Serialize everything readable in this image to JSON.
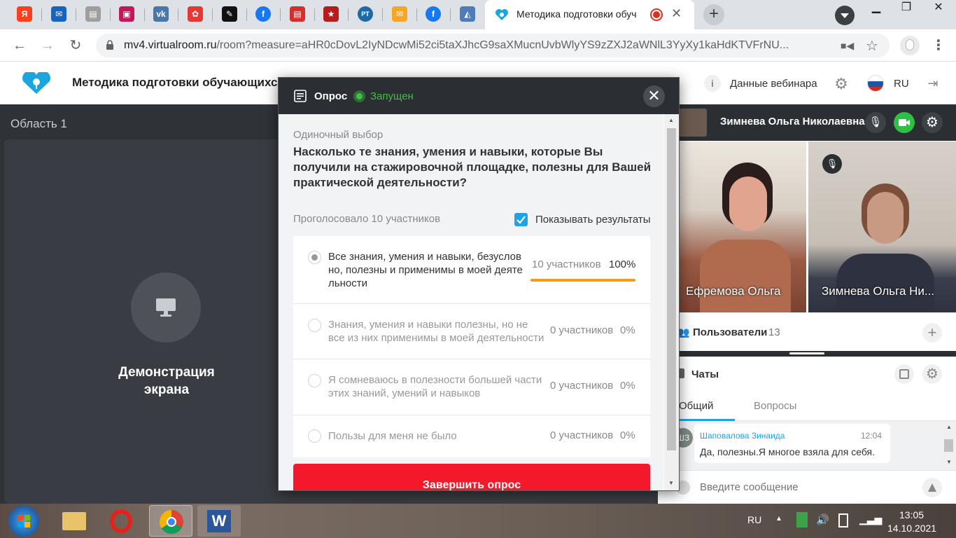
{
  "browser": {
    "active_tab_title": "Методика подготовки обуч",
    "url_host": "mv4.virtualroom.ru",
    "url_path": "/room?measure=aHR0cDovL2IyNDcwMi52ci5taXJhcG9saXMucnUvbWlyYS9zZXJ2aWNlL3YyXy1kaHdKTVFrNU..."
  },
  "app": {
    "title": "Методика подготовки обучающихся",
    "webinar_data_label": "Данные вебинара",
    "lang": "RU",
    "area_label": "Область 1",
    "screen_share_label": "Демонстрация экрана"
  },
  "sidebar": {
    "speaker_name": "Зимнева Ольга Николаевна",
    "video1_name": "Ефремова Ольга",
    "video2_name": "Зимнева Ольга Ни...",
    "users_label": "Пользователи",
    "users_count": "13",
    "chats_label": "Чаты",
    "tab_general": "Общий",
    "tab_questions": "Вопросы",
    "chat_avatar": "ШЗ",
    "chat_author": "Шаповалова Зинаида",
    "chat_time": "12:04",
    "chat_text": "Да, полезны.Я многое взяла для себя.",
    "chat_placeholder": "Введите сообщение"
  },
  "poll": {
    "title": "Опрос",
    "status": "Запущен",
    "type": "Одиночный выбор",
    "question": "Насколько те знания, умения и навыки, которые Вы получили на стажировочной площадке, полезны для Вашей практической деятельности?",
    "voted": "Проголосовало 10 участников",
    "show_results": "Показывать результаты",
    "options": [
      {
        "text": "Все знания, умения и навыки, безусловно, полезны и применимы в моей деятельности",
        "count": "10 участников",
        "pct": "100%"
      },
      {
        "text": "Знания, умения и навыки полезны, но не все из них применимы в моей деятельности",
        "count": "0 участников",
        "pct": "0%"
      },
      {
        "text": "Я сомневаюсь в полезности большей части этих знаний, умений и навыков",
        "count": "0 участников",
        "pct": "0%"
      },
      {
        "text": "Пользы для меня не было",
        "count": "0 участников",
        "pct": "0%"
      }
    ],
    "option1_progress": 1.0,
    "finish_label": "Завершить опрос"
  },
  "taskbar": {
    "lang": "RU",
    "time": "13:05",
    "date": "14.10.2021"
  }
}
